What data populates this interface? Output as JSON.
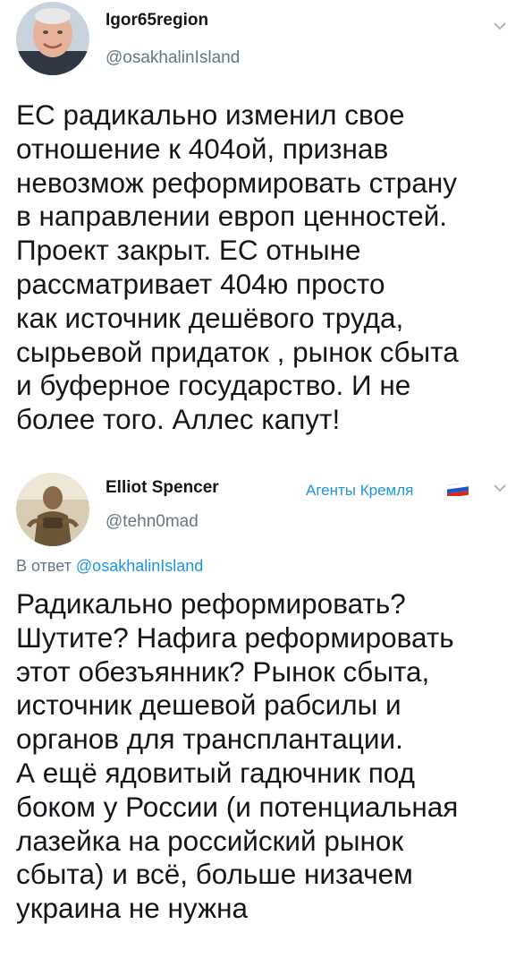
{
  "tweets": [
    {
      "name": "Igor65region",
      "handle": "@osakhalinIsland",
      "text": "ЕС радикально изменил свое\nотношение к 404ой, признав\nневозмож реформировать страну\nв направлении европ ценностей.\nПроект закрыт. ЕС отныне\nрассматривает 404ю просто\nкак источник дешёвого труда,\nсырьевой придаток , рынок сбыта\nи буферное государство. И не\nболее того. Аллес капут!",
      "avatar_icon": "user-avatar-photo",
      "menu_icon": "chevron-down-icon"
    },
    {
      "name": "Elliot Spencer",
      "handle": "@tehn0mad",
      "tag": "Агенты Кремля",
      "tag_flag": "russian-flag-icon",
      "reply_prefix": "В ответ",
      "reply_to": "@osakhalinIsland",
      "text": "Радикально реформировать?\nШутите? Нафига реформировать\nэтот обезъянник? Рынок сбыта,\nисточник дешевой рабсилы и\nорганов для трансплантации.\nА ещё ядовитый гадючник под\nбоком у России (и потенциальная\nлазейка на российский рынок\nсбыта) и всё, больше низачем\nукраина не нужна",
      "avatar_icon": "user-avatar-photo",
      "menu_icon": "chevron-down-icon"
    }
  ],
  "colors": {
    "text": "#14171a",
    "secondary": "#657786",
    "link": "#1b95e0"
  }
}
